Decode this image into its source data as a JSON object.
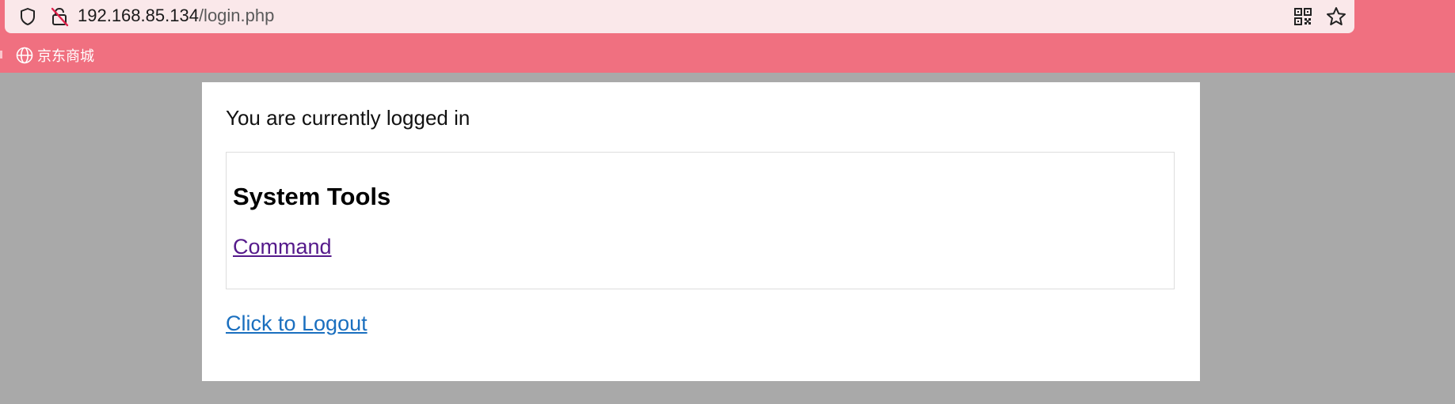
{
  "browser": {
    "url_host": "192.168.85.134",
    "url_path": "/login.php",
    "icons": {
      "shield": "shield-icon",
      "insecure_lock": "lock-slash-icon",
      "qr": "qr-code-icon",
      "bookmark_star": "star-icon"
    },
    "bookmarks": [
      {
        "label": "京东商城",
        "icon": "globe-icon"
      }
    ],
    "colors": {
      "chrome": "#f07080",
      "url_bar": "#fae8ea",
      "page_background": "#a9a9a9"
    }
  },
  "page": {
    "status_text": "You are currently logged in",
    "tools": {
      "title": "System Tools",
      "links": [
        {
          "label": "Command"
        }
      ]
    },
    "logout_label": "Click to Logout",
    "colors": {
      "visited_link": "#551a8b",
      "link": "#1a6fbf"
    }
  }
}
